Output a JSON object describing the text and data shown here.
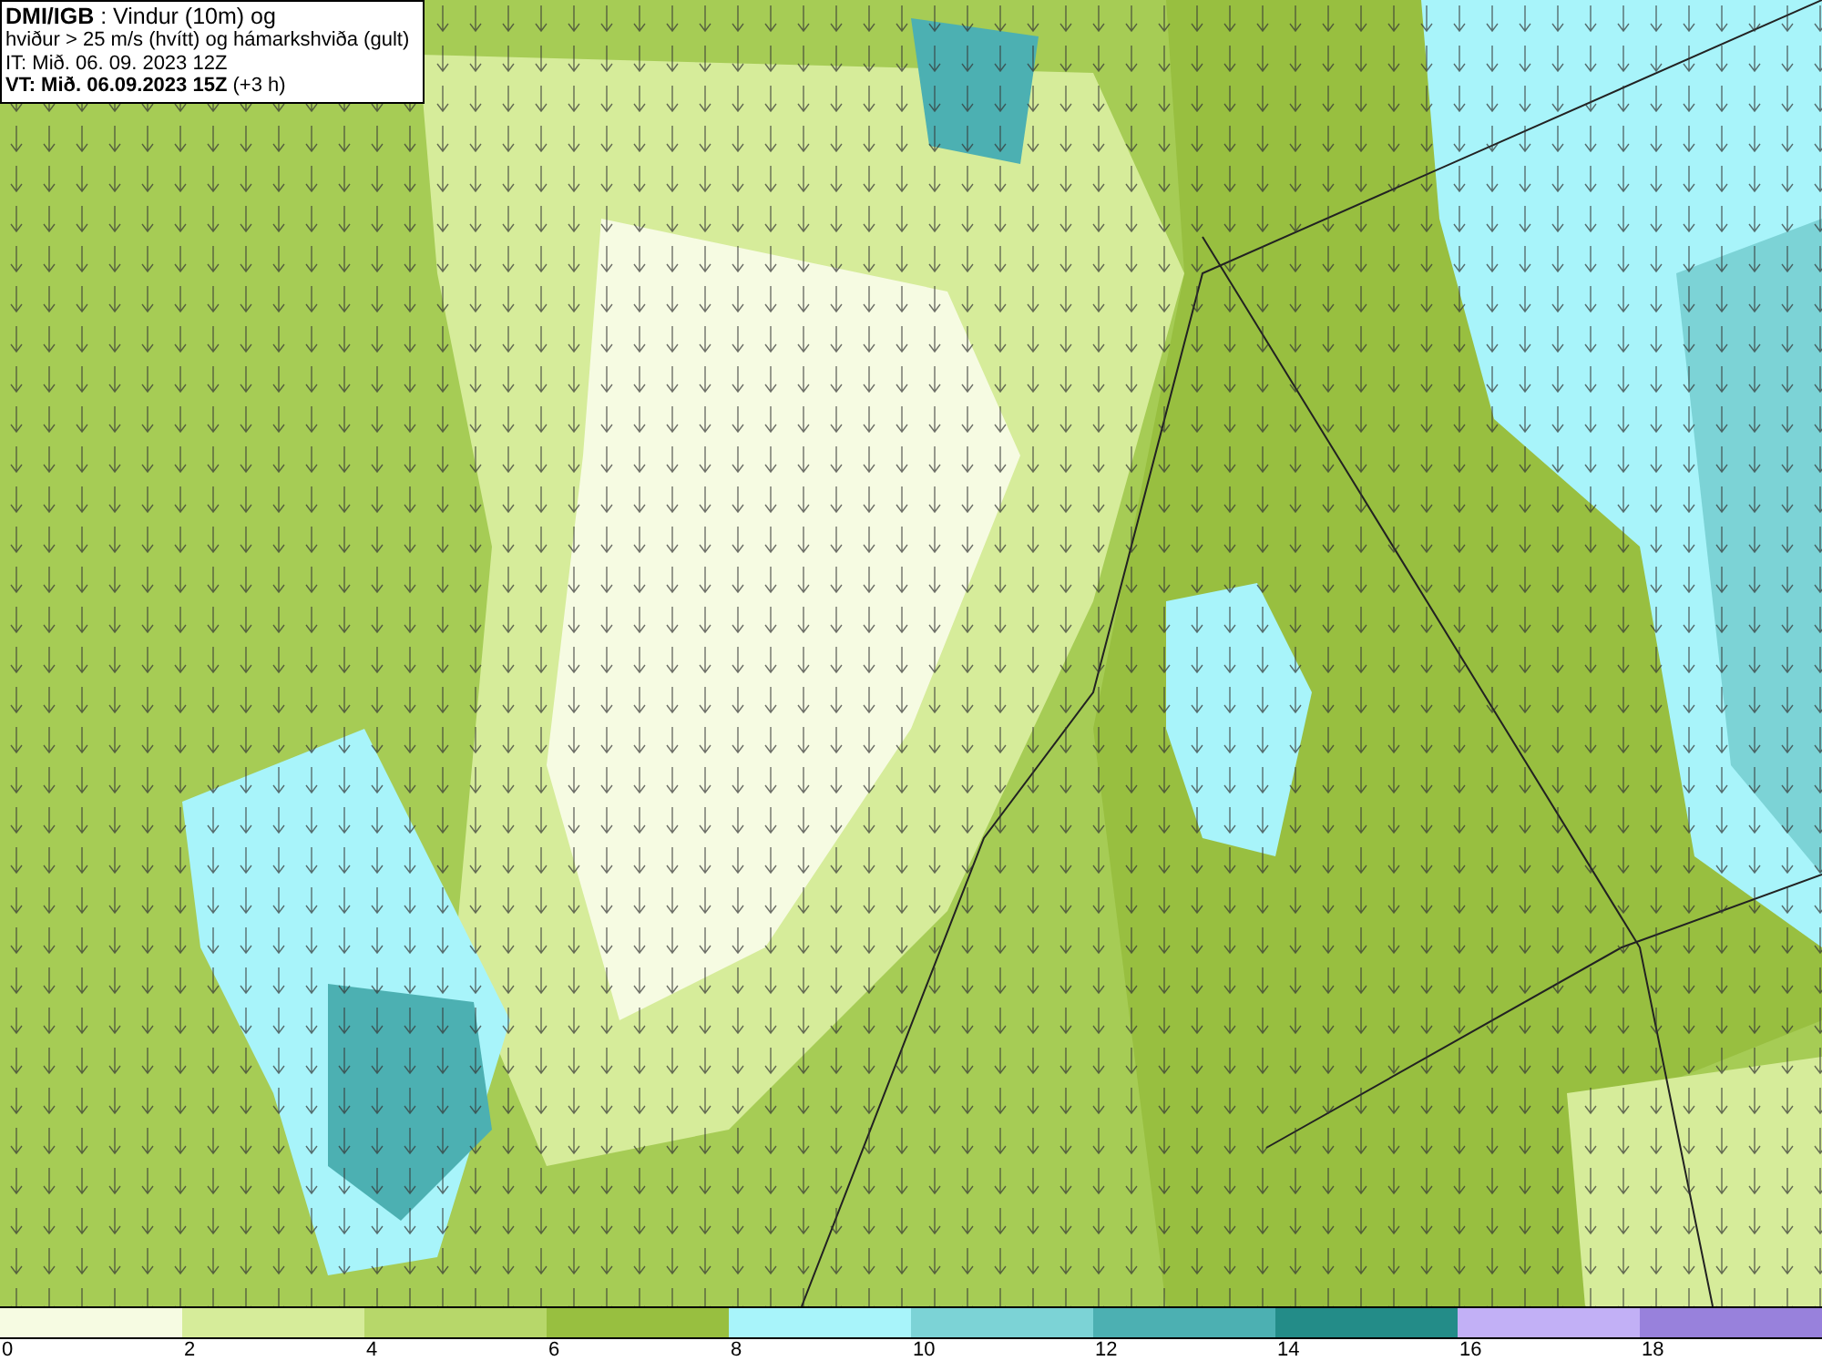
{
  "header": {
    "lines": [
      "**DMI/IGB** : Vindur (10m) og",
      "hviður > 25 m/s (hvítt) og hámarkshviða (gult)",
      "IT: Mið. 06. 09. 2023 12Z",
      "**VT: Mið. 06.09.2023 15Z** (+3 h)"
    ]
  },
  "legend": {
    "bins": [
      {
        "color": "#f6fbe2"
      },
      {
        "color": "#d6ec9a"
      },
      {
        "color": "#b7d76a"
      },
      {
        "color": "#98bf40"
      },
      {
        "color": "#a8f4fa"
      },
      {
        "color": "#7cd3d6"
      },
      {
        "color": "#4cb0b2"
      },
      {
        "color": "#238c88"
      },
      {
        "color": "#c2b0f6"
      },
      {
        "color": "#9881dc"
      }
    ],
    "ticks": [
      "0",
      "2",
      "4",
      "6",
      "8",
      "10",
      "12",
      "14",
      "16",
      "18"
    ]
  }
}
